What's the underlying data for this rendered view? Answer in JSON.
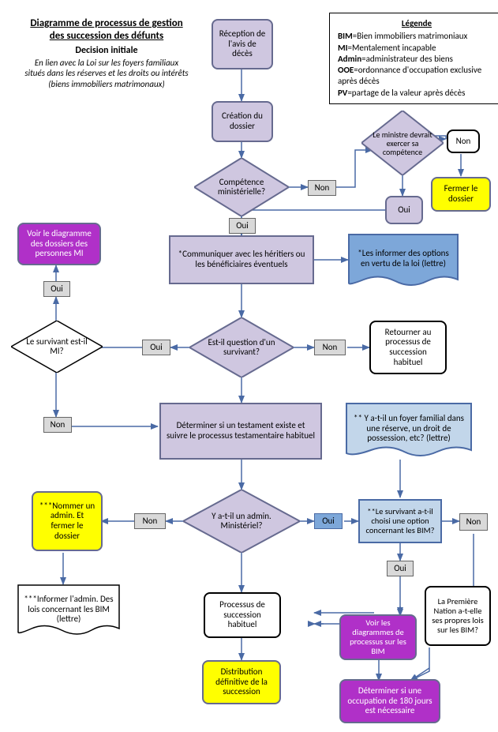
{
  "title": {
    "line1": "Diagramme de processus de gestion",
    "line2": "des succession des défunts",
    "sub": "Decision initiale",
    "note1": "En lien avec la Loi sur les foyers familiaux",
    "note2": "situés dans les réserves et les droits ou intérêts",
    "note3": "(biens immobiliers matrimonaux)"
  },
  "legend": {
    "title": "Légende",
    "items": [
      {
        "key": "BIM",
        "val": "=Bien immobiliers matrimoniaux"
      },
      {
        "key": "MI",
        "val": "=Mentalement incapable"
      },
      {
        "key": "Admin",
        "val": "=administrateur des biens"
      },
      {
        "key": "OOE",
        "val": "=ordonnance d'occupation exclusive après décès"
      },
      {
        "key": "PV",
        "val": "=partage de la valeur après décès"
      }
    ]
  },
  "nodes": {
    "n_reception": "Réception de l'avis de décès",
    "n_creation": "Création du dossier",
    "d_competence": "Compétence ministérielle?",
    "d_ministre": "Le ministre devrait exercer sa compétence",
    "n_fermer": "Fermer le dossier",
    "n_oui_box_minister": "Oui",
    "n_communiquer": "*Communiquer avec les héritiers ou les bénéficiaires éventuels",
    "n_informer_options": "*Les informer des options en vertu de la loi (lettre)",
    "n_voir_mi": "Voir le diagramme des dossiers des personnes MI",
    "d_survivant_mi": "Le survivant est-il MI?",
    "d_question_survivant": "Est-il question d'un survivant?",
    "n_retour_processus": "Retourner au processus de succession habituel",
    "n_determiner_testament": "Déterminer si un testament existe et suivre le processus testamentaire habituel",
    "n_foyer_lettre": "** Y a-t-il un foyer familial dans une réserve, un droit de possession, etc? (lettre)",
    "n_nommer_admin": "***Nommer un admin. Et fermer le dossier",
    "d_admin_min": "Y a-t-il un admin. Ministériel?",
    "n_survivant_choisi": "**Le survivant a-t-il choisi une option concernant les BIM?",
    "n_informer_admin": "***Informer l'admin. Des lois concernant les BIM (lettre)",
    "n_processus_hab": "Processus de succession habituel",
    "n_voir_diagrammes_bim": "Voir les diagrammes de processus sur les BIM",
    "n_premiere_nation": "La Première Nation a-t-elle ses propres lois sur les BIM?",
    "n_distribution": "Distribution définitive de la succession",
    "n_determiner_180": "Déterminer si une occupation de 180 jours est nécessaire"
  },
  "labels": {
    "oui": "Oui",
    "non": "Non"
  }
}
